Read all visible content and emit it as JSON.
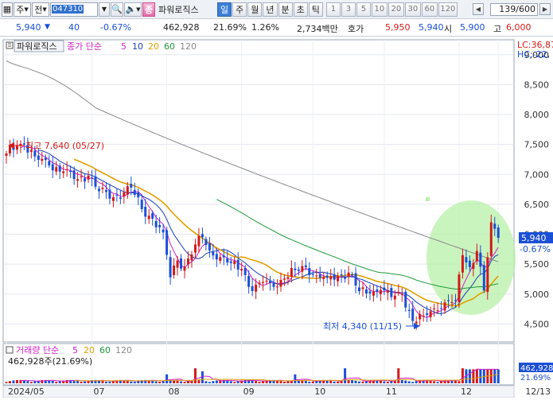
{
  "toolbar": {
    "market": "주",
    "type": "전",
    "code": "047310",
    "name": "파워로직스",
    "sound_icon": "speaker-icon",
    "periods": [
      "일",
      "주",
      "월",
      "년",
      "분",
      "초",
      "틱"
    ],
    "active_period": "일",
    "intervals": [
      "1",
      "3",
      "5",
      "10",
      "20",
      "30",
      "60",
      "120"
    ],
    "bar_count": "139/600"
  },
  "quote": {
    "price": "5,940",
    "change": "40",
    "change_pct": "-0.67%",
    "volume": "462,928",
    "volume_ratio": "21.69%",
    "turnover_pct": "1.26%",
    "amount": "2,734백만",
    "bid_label": "호가",
    "ask": "5,950",
    "bid": "5,940",
    "open_label": "시",
    "open": "5,900",
    "high_label": "고",
    "high": "6,000"
  },
  "main_chart": {
    "name_tag": "파워로직스",
    "legend_label": "종가 단순",
    "ma_periods": [
      "5",
      "10",
      "20",
      "60",
      "120"
    ],
    "lc_label": "LC:36,87",
    "hc_label": "HC:-22,",
    "current_price_tag": "5,940",
    "current_change_tag": "-0.67%",
    "high_annotation": "최고 7,640 (05/27)",
    "low_annotation": "최저 4,340 (11/15)"
  },
  "volume_chart": {
    "legend_label": "거래량 단순",
    "ma_periods": [
      "5",
      "20",
      "60",
      "120"
    ],
    "value_label": "462,928주(21.69%)",
    "right_tag_1": "462,928",
    "right_tag_2": "21.69%"
  },
  "colors": {
    "up": "#d21a1a",
    "down": "#1a4fd6",
    "ma5": "#d11ec8",
    "ma10": "#1a3fb0",
    "ma20": "#e0a000",
    "ma60": "#1e9a3a",
    "ma120": "#8a8a8a",
    "highlight_circle": "#b8f0a8"
  },
  "chart_data": {
    "type": "candlestick",
    "title": "",
    "y_ticks": [
      4500,
      5000,
      5500,
      6000,
      6500,
      7000,
      7500,
      8000,
      8500,
      9000
    ],
    "ylim": [
      4200,
      9250
    ],
    "x_labels": [
      {
        "label": "2024/05",
        "bar": 0
      },
      {
        "label": "07",
        "bar": 24
      },
      {
        "label": "08",
        "bar": 45
      },
      {
        "label": "09",
        "bar": 66
      },
      {
        "label": "10",
        "bar": 86
      },
      {
        "label": "11",
        "bar": 106
      },
      {
        "label": "12",
        "bar": 127
      },
      {
        "label": "12/13",
        "bar": 138
      }
    ],
    "anchors": [
      [
        0,
        7350
      ],
      [
        3,
        7480
      ],
      [
        5,
        7500
      ],
      [
        8,
        7300
      ],
      [
        12,
        7150
      ],
      [
        16,
        7050
      ],
      [
        20,
        6920
      ],
      [
        23,
        6980
      ],
      [
        26,
        6720
      ],
      [
        30,
        6620
      ],
      [
        33,
        6700
      ],
      [
        35,
        6780
      ],
      [
        38,
        6420
      ],
      [
        41,
        6260
      ],
      [
        44,
        6030
      ],
      [
        46,
        5280
      ],
      [
        48,
        5560
      ],
      [
        50,
        5460
      ],
      [
        53,
        5830
      ],
      [
        55,
        5950
      ],
      [
        57,
        5730
      ],
      [
        60,
        5620
      ],
      [
        63,
        5520
      ],
      [
        66,
        5420
      ],
      [
        69,
        5050
      ],
      [
        72,
        5200
      ],
      [
        75,
        5120
      ],
      [
        78,
        5260
      ],
      [
        81,
        5400
      ],
      [
        84,
        5450
      ],
      [
        87,
        5310
      ],
      [
        90,
        5270
      ],
      [
        93,
        5300
      ],
      [
        96,
        5360
      ],
      [
        99,
        5050
      ],
      [
        102,
        5010
      ],
      [
        105,
        5070
      ],
      [
        108,
        4950
      ],
      [
        111,
        5000
      ],
      [
        114,
        4550
      ],
      [
        117,
        4640
      ],
      [
        120,
        4760
      ],
      [
        123,
        4860
      ],
      [
        126,
        4900
      ],
      [
        128,
        5650
      ],
      [
        130,
        5450
      ],
      [
        132,
        5720
      ],
      [
        134,
        5060
      ],
      [
        136,
        6200
      ],
      [
        138,
        5940
      ]
    ],
    "volume_ratio_max": 1.0
  }
}
